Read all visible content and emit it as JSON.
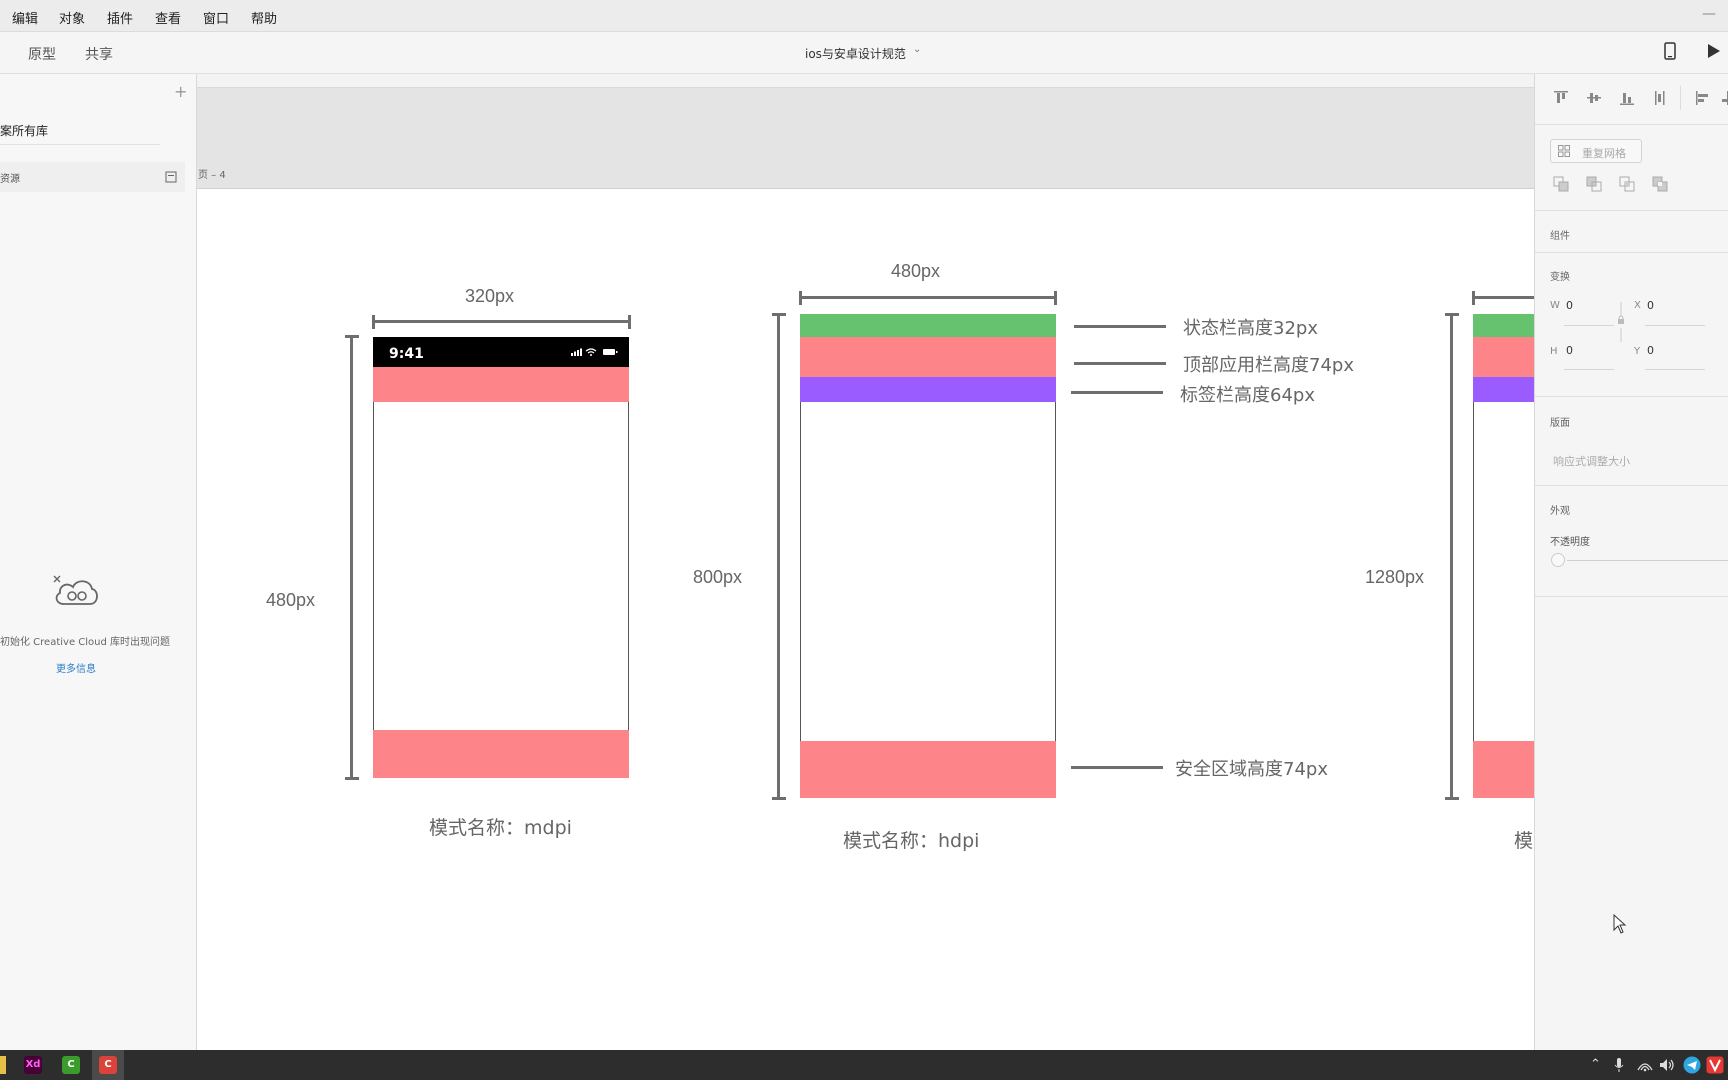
{
  "menu": [
    "编辑",
    "对象",
    "插件",
    "查看",
    "窗口",
    "帮助"
  ],
  "toolbar": {
    "tabs": [
      "原型",
      "共享"
    ],
    "doc_title": "ios与安卓设计规范",
    "chevron": "⌄",
    "device_icon": "phone-icon",
    "play_icon": "play-icon"
  },
  "left_panel": {
    "add": "+",
    "library_title": "案所有库",
    "resource_label": "资源",
    "cc_error": "初始化 Creative Cloud 库时出现问题",
    "more_info": "更多信息"
  },
  "canvas": {
    "artboard_label": "页 – 4",
    "phone1": {
      "width_label": "320px",
      "height_label": "480px",
      "status_time": "9:41",
      "caption": "模式名称：mdpi"
    },
    "phone2": {
      "width_label": "480px",
      "height_label": "800px",
      "caption": "模式名称：hdpi",
      "notes": {
        "status": "状态栏高度32px",
        "appbar": "顶部应用栏高度74px",
        "tabbar": "标签栏高度64px",
        "safe": "安全区域高度74px"
      }
    },
    "phone3": {
      "height_label": "1280px",
      "caption_partial": "模"
    }
  },
  "right_panel": {
    "repeat_grid": "重复网格",
    "component": "组件",
    "transform": "变换",
    "w_label": "W",
    "w_value": "0",
    "x_label": "X",
    "x_value": "0",
    "h_label": "H",
    "h_value": "0",
    "y_label": "Y",
    "y_value": "0",
    "layout": "版面",
    "responsive": "响应式调整大小",
    "appearance": "外观",
    "opacity": "不透明度"
  },
  "colors": {
    "status_green": "#66c26e",
    "pink": "#fd8489",
    "purple": "#9b5cff",
    "accent_blue": "#2d7ec9"
  },
  "taskbar": {
    "xd_label": "Xd",
    "c_label": "C"
  }
}
